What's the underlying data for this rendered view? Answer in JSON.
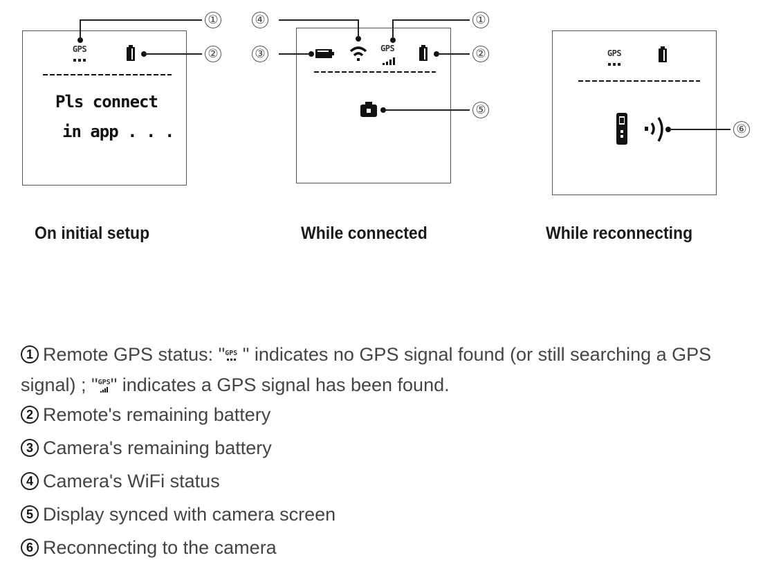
{
  "panels": [
    {
      "id": "initial-setup",
      "caption": "On initial setup",
      "gps_label": "GPS",
      "gps_state": "searching",
      "message_line1": "Pls connect",
      "message_line2": "in app . . .",
      "callouts": [
        "①",
        "②"
      ]
    },
    {
      "id": "connected",
      "caption": "While connected",
      "gps_label": "GPS",
      "gps_state": "found",
      "callouts": [
        "④",
        "①",
        "③",
        "②",
        "⑤"
      ]
    },
    {
      "id": "reconnecting",
      "caption": "While reconnecting",
      "gps_label": "GPS",
      "gps_state": "searching",
      "callouts": [
        "⑥"
      ]
    }
  ],
  "legend": {
    "item1": {
      "num": "1",
      "prefix": "Remote GPS status: \"",
      "mid1": " \" indicates no GPS signal found (or still searching a GPS",
      "line2_prefix": "signal) ; \"",
      "line2_suffix": "\" indicates a GPS signal has been found.",
      "icon_label": "GPS"
    },
    "items": [
      {
        "num": "2",
        "text": "Remote's remaining battery"
      },
      {
        "num": "3",
        "text": "Camera's remaining battery"
      },
      {
        "num": "4",
        "text": "Camera's WiFi status"
      },
      {
        "num": "5",
        "text": "Display synced with camera screen"
      },
      {
        "num": "6",
        "text": "Reconnecting to the camera"
      }
    ]
  }
}
